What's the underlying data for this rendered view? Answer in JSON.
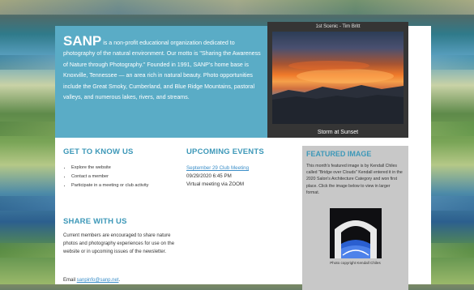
{
  "hero": {
    "brand": "SANP",
    "text": " is a non-profit educational organization dedicated to photography of the natural environment. Our motto is \"Sharing the Awareness of Nature through Photography.\" Founded in 1991, SANP's home base is Knoxville, Tennessee — an area rich in natural beauty. Photo opportunities include the Great Smoky, Cumberland, and Blue Ridge Mountains, pastoral valleys, and numerous lakes, rivers, and streams."
  },
  "featured_header": {
    "top_label": "1st Scenic - Tim Britt",
    "caption": "Storm at Sunset"
  },
  "get_to_know": {
    "heading": "GET TO KNOW US",
    "items": [
      "Explore the website",
      "Contact a member",
      "Participate in a meeting or club activity"
    ]
  },
  "events": {
    "heading": "UPCOMING EVENTS",
    "link": "September 29 Club Meeting",
    "datetime": "09/29/2020 6:45 PM",
    "location": "Virtual meeting via ZOOM"
  },
  "share": {
    "heading": "SHARE WITH US",
    "text": "Current members are encouraged to share nature photos and photography experiences for use on the website or in upcoming issues of the newsletter."
  },
  "email": {
    "label": "Email ",
    "address": "sanpinfo@sanp.net",
    "suffix": "."
  },
  "featured_image": {
    "heading": "FEATURED IMAGE",
    "text": "This month's featured image is by Kendall Chiles called \"Bridge over Clouds\" Kendall entered it in the 2020 Salon's Architecture Category and won first place. Click the image below to view in larger format.",
    "credit": "Photo copyright Kendall Chiles"
  }
}
